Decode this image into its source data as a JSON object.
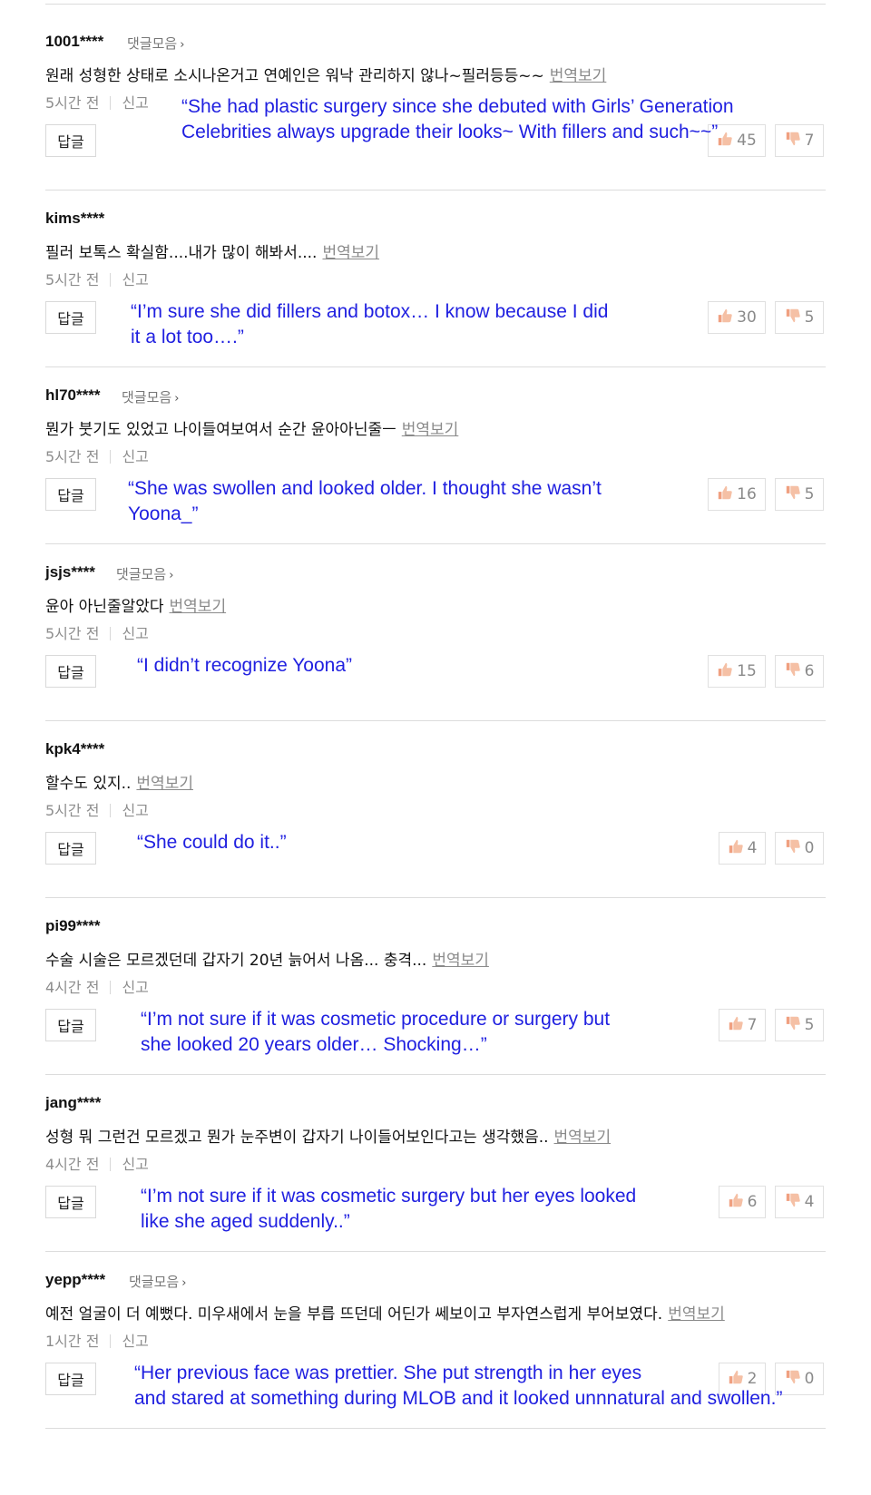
{
  "labels": {
    "collect": "댓글모음",
    "translate": "번역보기",
    "report": "신고",
    "reply": "답글"
  },
  "comments": [
    {
      "author": "1001****",
      "has_collect": true,
      "text": "원래 성형한 상태로 소시나온거고 연예인은 워낙 관리하지 않나~필러등등~~",
      "time": "5시간 전",
      "likes": "45",
      "dislikes": "7",
      "translation_line1": "“She had plastic surgery since she debuted with Girls’ Generation",
      "translation_line2": "Celebrities always upgrade their looks~ With fillers and such~~”"
    },
    {
      "author": "kims****",
      "has_collect": false,
      "text": "필러 보톡스 확실함....내가 많이 해봐서....",
      "time": "5시간 전",
      "likes": "30",
      "dislikes": "5",
      "translation_line1": "“I’m sure she did fillers and botox… I know because I did",
      "translation_line2": "it a lot too….”"
    },
    {
      "author": "hl70****",
      "has_collect": true,
      "text": "뭔가 붓기도 있었고 나이들여보여서 순간 윤아아닌줄ㅡ",
      "time": "5시간 전",
      "likes": "16",
      "dislikes": "5",
      "translation_line1": "“She was swollen and looked older. I thought she wasn’t",
      "translation_line2": "Yoona_”"
    },
    {
      "author": "jsjs****",
      "has_collect": true,
      "text": "윤아 아닌줄알았다",
      "time": "5시간 전",
      "likes": "15",
      "dislikes": "6",
      "translation_line1": "“I didn’t recognize Yoona”",
      "translation_line2": ""
    },
    {
      "author": "kpk4****",
      "has_collect": false,
      "text": "할수도 있지..",
      "time": "5시간 전",
      "likes": "4",
      "dislikes": "0",
      "translation_line1": "“She could do it..”",
      "translation_line2": ""
    },
    {
      "author": "pi99****",
      "has_collect": false,
      "text": "수술 시술은 모르겠던데 갑자기 20년 늙어서 나옴... 충격...",
      "time": "4시간 전",
      "likes": "7",
      "dislikes": "5",
      "translation_line1": "“I’m not sure if it was cosmetic procedure or surgery but",
      "translation_line2": "she looked 20 years older… Shocking…”"
    },
    {
      "author": "jang****",
      "has_collect": false,
      "text": "성형 뭐 그런건 모르겠고 뭔가 눈주변이 갑자기 나이들어보인다고는 생각했음..",
      "time": "4시간 전",
      "likes": "6",
      "dislikes": "4",
      "translation_line1": "“I’m not sure if it was cosmetic surgery but her eyes looked",
      "translation_line2": "like she aged suddenly..”"
    },
    {
      "author": "yepp****",
      "has_collect": true,
      "text": "예전 얼굴이 더 예뻤다. 미우새에서 눈을 부릅 뜨던데 어딘가 쎄보이고 부자연스럽게 부어보였다.",
      "time": "1시간 전",
      "likes": "2",
      "dislikes": "0",
      "translation_line1": "“Her previous face was prettier. She put strength in her eyes",
      "translation_line2": "and stared at something during MLOB and it looked unnnatural and swollen.”"
    }
  ],
  "colors": {
    "translation_text": "#2020e0",
    "meta_text": "#8d8d8d",
    "divider": "#dcdcdc"
  }
}
